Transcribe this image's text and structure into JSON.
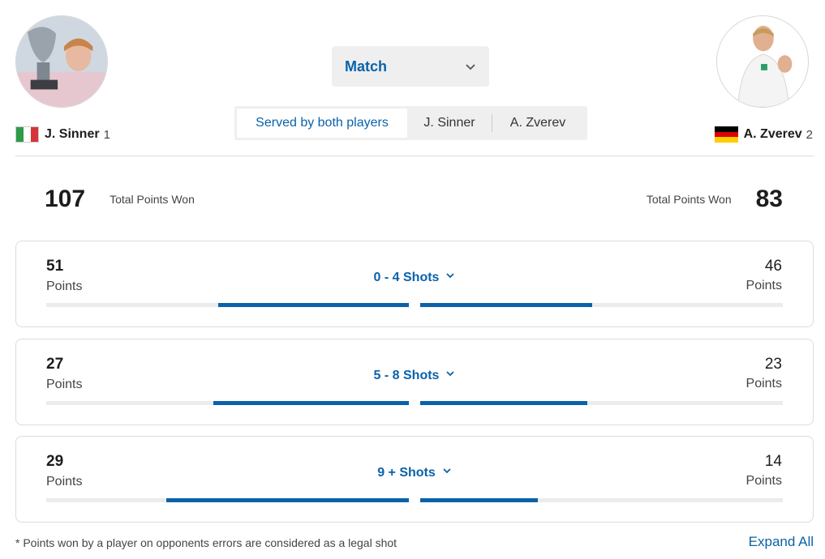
{
  "players": {
    "left": {
      "name": "J. Sinner",
      "seed": "1",
      "flag": "flag-italy-icon",
      "avatar": "avatar-sinner"
    },
    "right": {
      "name": "A. Zverev",
      "seed": "2",
      "flag": "flag-germany-icon",
      "avatar": "avatar-zverev"
    }
  },
  "match_select": {
    "label": "Match"
  },
  "serve_filter": {
    "options": [
      "Served by both players",
      "J. Sinner",
      "A. Zverev"
    ],
    "selected": "Served by both players"
  },
  "totals": {
    "label": "Total Points Won",
    "left": "107",
    "right": "83"
  },
  "rallies": [
    {
      "label": "0 - 4 Shots",
      "left": {
        "value": "51",
        "label": "Points",
        "fraction": 0.525
      },
      "right": {
        "value": "46",
        "label": "Points",
        "fraction": 0.475
      }
    },
    {
      "label": "5 - 8 Shots",
      "left": {
        "value": "27",
        "label": "Points",
        "fraction": 0.54
      },
      "right": {
        "value": "23",
        "label": "Points",
        "fraction": 0.46
      }
    },
    {
      "label": "9 + Shots",
      "left": {
        "value": "29",
        "label": "Points",
        "fraction": 0.67
      },
      "right": {
        "value": "14",
        "label": "Points",
        "fraction": 0.325
      }
    }
  ],
  "footnote": "* Points won by a player on opponents errors are considered as a legal shot",
  "expand_all": "Expand All",
  "colors": {
    "accent": "#0a62a9",
    "track": "#ececec",
    "panel": "#efefef"
  }
}
